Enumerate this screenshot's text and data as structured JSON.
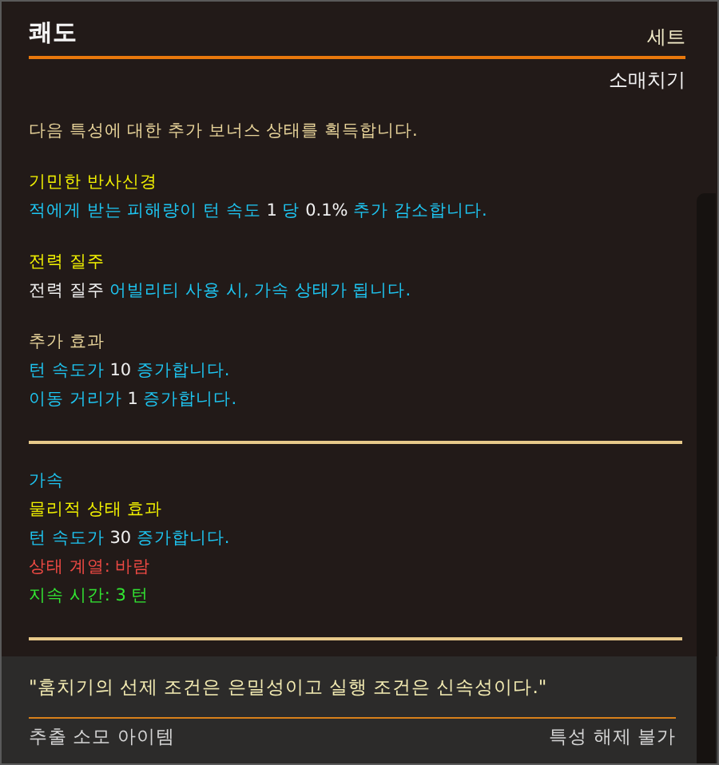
{
  "header": {
    "title": "쾌도",
    "tag": "세트",
    "subtitle": "소매치기"
  },
  "groups": [
    {
      "rule_after": false,
      "lines": [
        [
          {
            "text": "다음 특성에 대한 추가 보너스 상태를 획득합니다.",
            "color": "#e8d49a"
          }
        ]
      ]
    },
    {
      "rule_after": false,
      "lines": [
        [
          {
            "text": "기민한 반사신경",
            "color": "#f2f200"
          }
        ],
        [
          {
            "text": "적에게 받는 피해량이 턴 속도 ",
            "color": "#1ec6f2"
          },
          {
            "text": "1",
            "color": "#f0f0f0"
          },
          {
            "text": " 당 ",
            "color": "#1ec6f2"
          },
          {
            "text": "0.1%",
            "color": "#f0f0f0"
          },
          {
            "text": " 추가 감소합니다.",
            "color": "#1ec6f2"
          }
        ]
      ]
    },
    {
      "rule_after": false,
      "lines": [
        [
          {
            "text": "전력 질주",
            "color": "#f2f200"
          }
        ],
        [
          {
            "text": "전력 질주",
            "color": "#f0f0f0"
          },
          {
            "text": " 어빌리티 사용 시, 가속 상태가 됩니다.",
            "color": "#1ec6f2"
          }
        ]
      ]
    },
    {
      "rule_after": true,
      "lines": [
        [
          {
            "text": "추가 효과",
            "color": "#e8d49a"
          }
        ],
        [
          {
            "text": "턴 속도가 ",
            "color": "#1ec6f2"
          },
          {
            "text": "10",
            "color": "#f0f0f0"
          },
          {
            "text": " 증가합니다.",
            "color": "#1ec6f2"
          }
        ],
        [
          {
            "text": "이동 거리가 ",
            "color": "#1ec6f2"
          },
          {
            "text": "1",
            "color": "#f0f0f0"
          },
          {
            "text": " 증가합니다.",
            "color": "#1ec6f2"
          }
        ]
      ]
    },
    {
      "rule_after": true,
      "lines": [
        [
          {
            "text": "가속",
            "color": "#1ec6f2"
          }
        ],
        [
          {
            "text": "물리적 상태 효과",
            "color": "#f2f200"
          }
        ],
        [
          {
            "text": "턴 속도가 ",
            "color": "#1ec6f2"
          },
          {
            "text": "30",
            "color": "#f0f0f0"
          },
          {
            "text": " 증가합니다.",
            "color": "#1ec6f2"
          }
        ],
        [
          {
            "text": "상태 계열: 바람",
            "color": "#f04a44"
          }
        ],
        [
          {
            "text": "지속 시간: 3 턴",
            "color": "#32e632"
          }
        ]
      ]
    }
  ],
  "quote": "\"훔치기의 선제 조건은 은밀성이고 실행 조건은 신속성이다.\"",
  "footer": {
    "left": "추출 소모 아이템",
    "right": "특성 해제 불가"
  }
}
